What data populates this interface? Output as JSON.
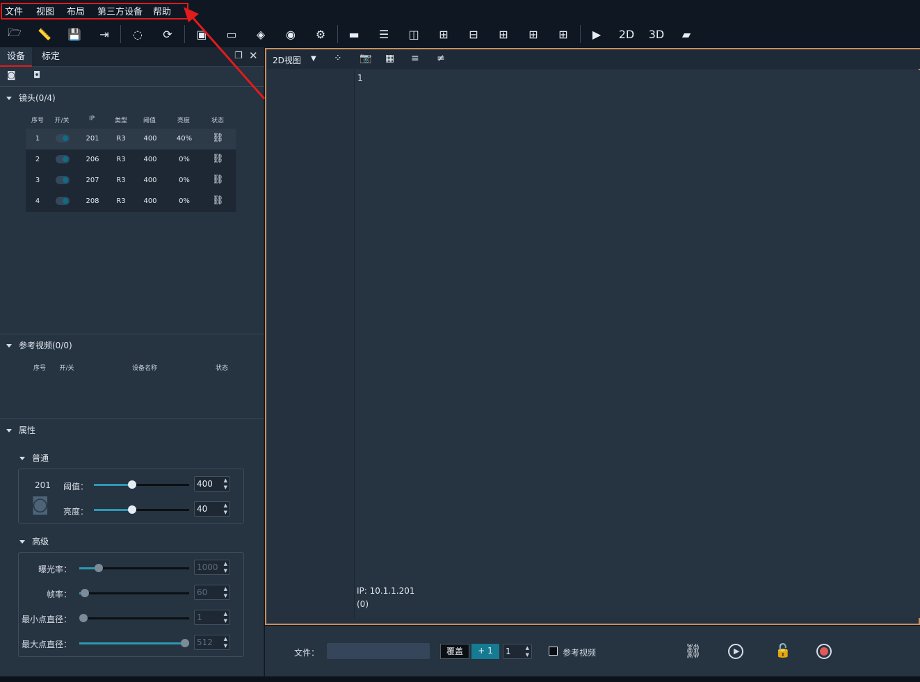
{
  "menu": {
    "items": [
      "文件",
      "视图",
      "布局",
      "第三方设备",
      "帮助"
    ]
  },
  "left_panel": {
    "tabs": [
      "设备",
      "标定"
    ],
    "lens_section": {
      "title": "镜头(0/4)",
      "headers": [
        "序号",
        "开/关",
        "IP",
        "类型",
        "阈值",
        "亮度",
        "状态"
      ],
      "rows": [
        {
          "no": "1",
          "ip": "201",
          "type": "R3",
          "threshold": "400",
          "brightness": "40%"
        },
        {
          "no": "2",
          "ip": "206",
          "type": "R3",
          "threshold": "400",
          "brightness": "0%"
        },
        {
          "no": "3",
          "ip": "207",
          "type": "R3",
          "threshold": "400",
          "brightness": "0%"
        },
        {
          "no": "4",
          "ip": "208",
          "type": "R3",
          "threshold": "400",
          "brightness": "0%"
        }
      ]
    },
    "ref_section": {
      "title": "参考视频(0/0)",
      "headers": [
        "序号",
        "开/关",
        "设备名称",
        "状态"
      ]
    },
    "props": {
      "title": "属性",
      "normal": {
        "title": "普通",
        "camera_id": "201",
        "threshold_label": "阈值：",
        "threshold_value": "400",
        "threshold_level": 0.4,
        "brightness_label": "亮度：",
        "brightness_value": "40",
        "brightness_level": 0.4
      },
      "advanced": {
        "title": "高级",
        "exposure_label": "曝光率：",
        "exposure_value": "1000",
        "exposure_level": 0.18,
        "fps_label": "帧率：",
        "fps_value": "60",
        "fps_level": 0.05,
        "min_label": "最小点直径：",
        "min_value": "1",
        "min_level": 0.0,
        "max_label": "最大点直径：",
        "max_value": "512",
        "max_level": 1.0
      }
    }
  },
  "view": {
    "mode": "2D视图",
    "channel": "1",
    "ip_text": "IP: 10.1.1.201",
    "count_text": "(0)"
  },
  "bottom": {
    "file_label": "文件：",
    "overwrite_label": "覆盖",
    "plus_label": "+ 1",
    "spin_value": "1",
    "ref_video_label": "参考视频"
  },
  "colors": {
    "accent": "#2e98b6",
    "highlight": "#e21b1b",
    "view_border": "#c98f5a",
    "record": "#e05a5a"
  }
}
